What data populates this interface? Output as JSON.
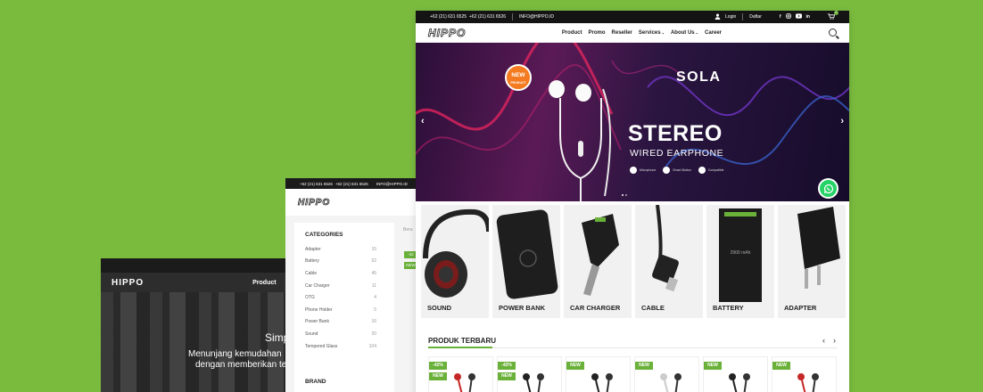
{
  "colors": {
    "background": "#7abb3e",
    "accent": "#6ab13a",
    "dark": "#141414",
    "whatsapp": "#25d366"
  },
  "back_screen": {
    "logo": "HIPPO",
    "nav_item": "Product",
    "hero_title": "Simp",
    "hero_line1": "Menunjang kemudahan",
    "hero_line2": "dengan memberikan te"
  },
  "middle_screen": {
    "topbar": [
      "+62 (21) 631 6526",
      "+62 (21) 631 6526",
      "INFO@HIPPO.ID"
    ],
    "logo": "HIPPO",
    "categories_title": "CATEGORIES",
    "categories": [
      {
        "name": "Adapter",
        "count": "15"
      },
      {
        "name": "Battery",
        "count": "52"
      },
      {
        "name": "Cable",
        "count": "45"
      },
      {
        "name": "Car Charger",
        "count": "11"
      },
      {
        "name": "OTG",
        "count": "4"
      },
      {
        "name": "Phone Holder",
        "count": "5"
      },
      {
        "name": "Power Bank",
        "count": "16"
      },
      {
        "name": "Sound",
        "count": "20"
      },
      {
        "name": "Tempered Glass",
        "count": "104"
      }
    ],
    "brand_title": "BRAND",
    "crumb": "Bera",
    "badges": [
      "-42",
      "NEW"
    ]
  },
  "front_screen": {
    "topbar": {
      "phone1": "+62 (21) 631 6525",
      "phone2": "+62 (21) 631 6526",
      "email": "INFO@HIPPO.ID",
      "login": "Login",
      "register": "Daftar",
      "cart_count": "0"
    },
    "logo": "HIPPO",
    "menu": [
      "Product",
      "Promo",
      "Reseller",
      "Services",
      "About Us",
      "Career"
    ],
    "banner": {
      "badge_line1": "NEW",
      "badge_line2": "PRODUCT",
      "brand": "SOLA",
      "title": "STEREO",
      "subtitle": "WIRED EARPHONE",
      "features": [
        "Microphone",
        "Smart Button",
        "Compatible"
      ]
    },
    "categories": [
      "SOUND",
      "POWER BANK",
      "CAR CHARGER",
      "CABLE",
      "BATTERY",
      "ADAPTER"
    ],
    "section_title": "PRODUK TERBARU",
    "product_badges": [
      [
        "-42%",
        "NEW"
      ],
      [
        "-42%",
        "NEW"
      ],
      [
        "NEW"
      ],
      [
        "NEW"
      ],
      [
        "NEW"
      ],
      [
        "NEW"
      ]
    ]
  }
}
